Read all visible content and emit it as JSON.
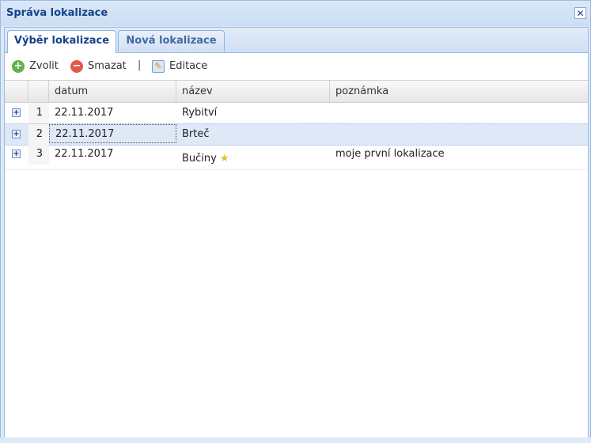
{
  "window": {
    "title": "Správa lokalizace"
  },
  "tabs": [
    {
      "label": "Výběr lokalizace",
      "active": true
    },
    {
      "label": "Nová lokalizace",
      "active": false
    }
  ],
  "toolbar": {
    "choose_label": "Zvolit",
    "delete_label": "Smazat",
    "separator": "|",
    "edit_label": "Editace"
  },
  "grid": {
    "columns": [
      "datum",
      "název",
      "poznámka"
    ],
    "rows": [
      {
        "num": "1",
        "datum": "22.11.2017",
        "nazev": "Rybitví",
        "poznamka": "",
        "starred": false
      },
      {
        "num": "2",
        "datum": "22.11.2017",
        "nazev": "Brteč",
        "poznamka": "",
        "starred": false,
        "selected": true
      },
      {
        "num": "3",
        "datum": "22.11.2017",
        "nazev": "Bučiny",
        "poznamka": "moje první lokalizace",
        "starred": true
      }
    ]
  },
  "colors": {
    "accent": "#15428b",
    "border": "#99bbe8",
    "selected_row": "#dfe8f6"
  }
}
